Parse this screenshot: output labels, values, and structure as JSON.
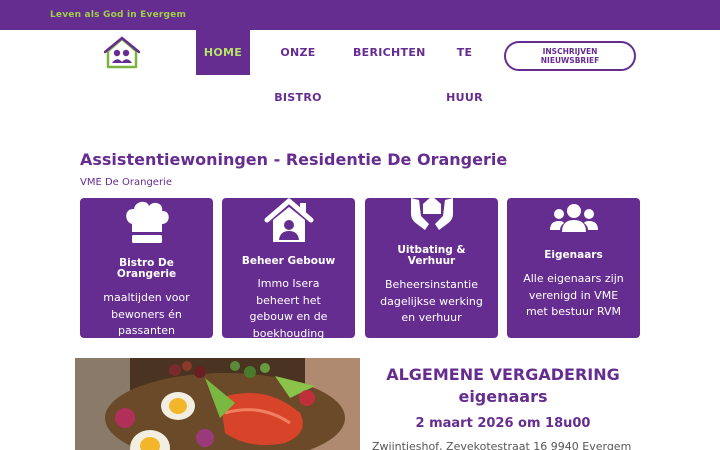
{
  "topbar": {
    "tagline": "Leven als God in Evergem"
  },
  "nav": {
    "home": "HOME",
    "bistro": "ONZE BISTRO",
    "berichten": "BERICHTEN",
    "tehuur": "TE HUUR",
    "newsletter": "INSCHRIJVEN NIEUWSBRIEF"
  },
  "page": {
    "title": "Assistentiewoningen - Residentie De Orangerie",
    "subtitle": "VME De Orangerie"
  },
  "cards": [
    {
      "icon": "chef-hat-icon",
      "title": "Bistro De Orangerie",
      "text": "maaltijden voor bewoners én passanten"
    },
    {
      "icon": "house-user-icon",
      "title": "Beheer Gebouw",
      "text": "Immo Isera beheert het gebouw en de boekhouding"
    },
    {
      "icon": "hands-house-icon",
      "title": "Uitbating & Verhuur",
      "text": "Beheersinstantie dagelijkse werking en verhuur"
    },
    {
      "icon": "users-icon",
      "title": "Eigenaars",
      "text": "Alle eigenaars zijn verenigd in VME met bestuur RVM"
    }
  ],
  "meeting": {
    "title": "ALGEMENE VERGADERING eigenaars",
    "date": "2 maart 2026 om 18u00",
    "address": "Zwijntjeshof, Zevekotestraat 16 9940 Evergem"
  },
  "colors": {
    "brand": "#662d91",
    "accent": "#9fd04a"
  }
}
